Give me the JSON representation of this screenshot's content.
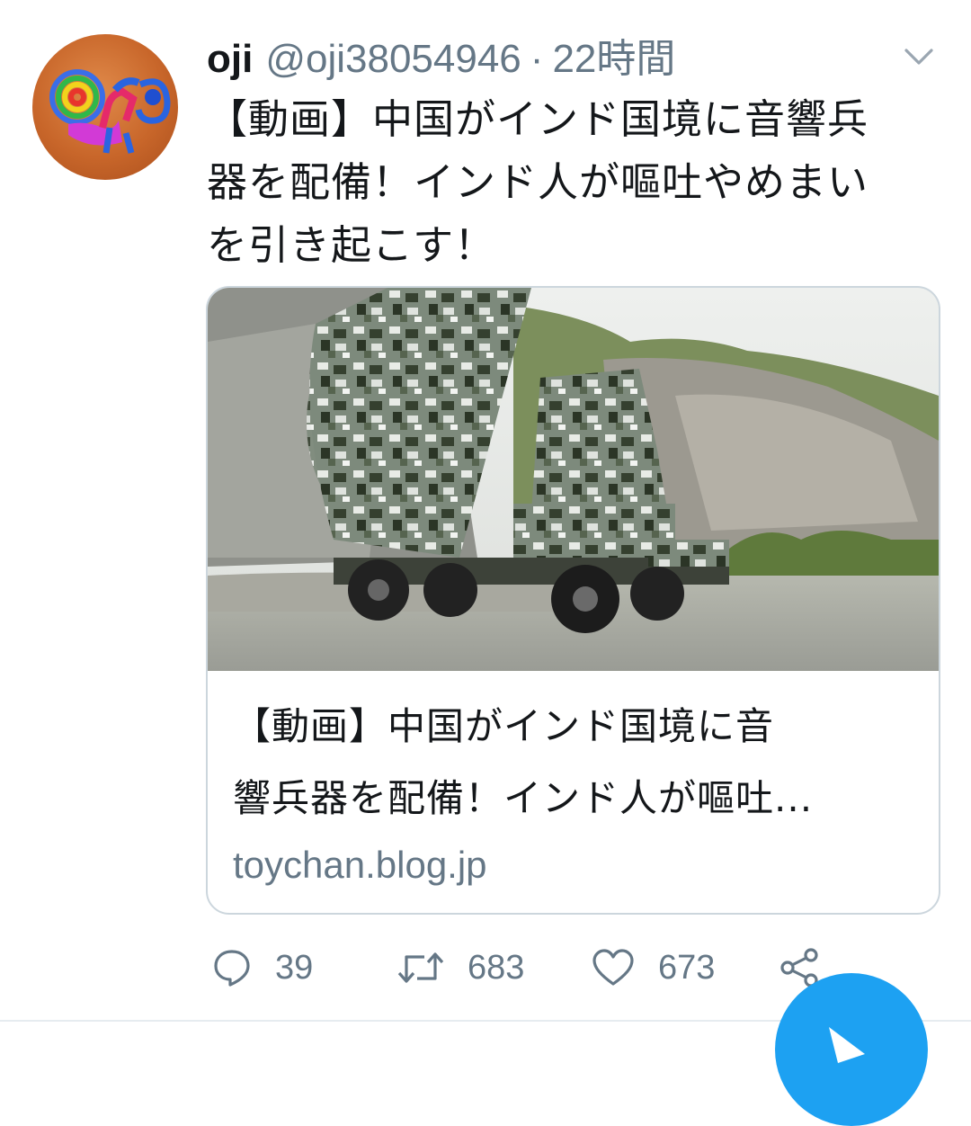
{
  "tweet": {
    "display_name": "oji",
    "handle": "@oji38054946",
    "separator": "·",
    "time": "22時間",
    "text_lines": [
      "【動画】中国がインド国境に音響兵",
      "器を配備！インド人が嘔吐やめまい",
      "を引き起こす！"
    ]
  },
  "card": {
    "title_lines": [
      "【動画】中国がインド国境に音",
      "響兵器を配備！インド人が嘔吐..."
    ],
    "domain": "toychan.blog.jp"
  },
  "actions": {
    "reply_count": "39",
    "retweet_count": "683",
    "like_count": "673"
  },
  "colors": {
    "accent": "#1da1f2",
    "secondary_text": "#657786",
    "primary_text": "#14171a",
    "border": "#ccd6dd"
  },
  "icons": {
    "reply": "reply-icon",
    "retweet": "retweet-icon",
    "like": "heart-icon",
    "share": "share-icon",
    "caret": "chevron-down-icon",
    "compose": "compose-icon"
  }
}
